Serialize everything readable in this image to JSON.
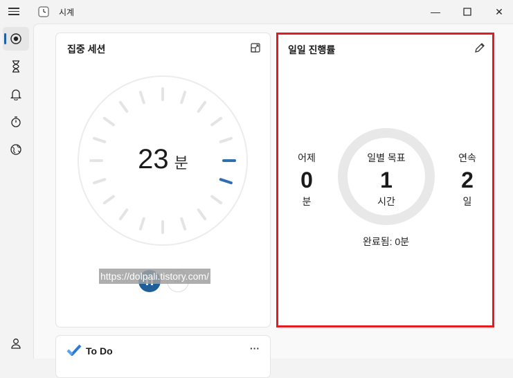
{
  "window": {
    "title": "시계",
    "minimize_glyph": "—",
    "maximize_glyph": "☐",
    "close_glyph": "✕"
  },
  "rail": {
    "items": [
      "focus-sessions-icon",
      "timer-icon",
      "alarm-icon",
      "stopwatch-icon",
      "world-clock-icon"
    ],
    "bottom": "account-icon",
    "accent": "#1f5fa6"
  },
  "focus": {
    "title": "집중 세션",
    "minutes": "23",
    "unit": "분",
    "watermark": "https://dolpali.tistory.com/",
    "more_label": "···"
  },
  "progress": {
    "title": "일일 진행률",
    "yesterday_label": "어제",
    "yesterday_value": "0",
    "yesterday_unit": "분",
    "goal_label": "일별 목표",
    "goal_value": "1",
    "goal_unit": "시간",
    "streak_label": "연속",
    "streak_value": "2",
    "streak_unit": "일",
    "completed": "완료됨: 0분",
    "highlight_color": "#e21b23"
  },
  "todo": {
    "title": "To Do",
    "menu": "···"
  }
}
